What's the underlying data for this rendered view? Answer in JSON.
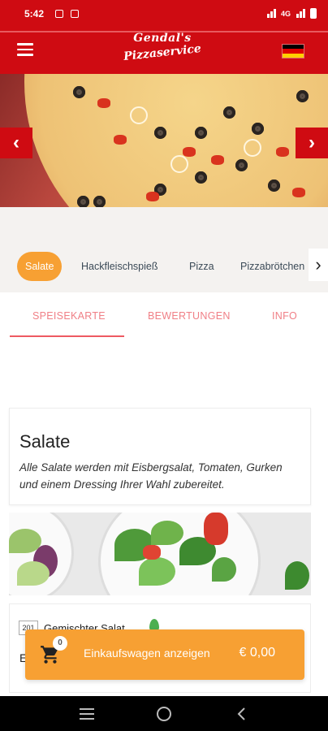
{
  "status_bar": {
    "time": "5:42",
    "network": "4G"
  },
  "header": {
    "logo_line1": "Gendal's",
    "logo_line2": "Pizzaservice",
    "language": "de"
  },
  "hero": {
    "prev_icon": "chevron-left-icon",
    "next_icon": "chevron-right-icon"
  },
  "categories": {
    "items": [
      "Salate",
      "Hackfleischspieß",
      "Pizza",
      "Pizzabrötchen"
    ],
    "active": "Salate"
  },
  "tabs": {
    "items": [
      "SPEISEKARTE",
      "BEWERTUNGEN",
      "INFO"
    ],
    "active": "SPEISEKARTE"
  },
  "section": {
    "title": "Salate",
    "description": "Alle Salate werden mit Eisbergsalat, Tomaten, Gurken und einem Dressing Ihrer Wahl zubereitet."
  },
  "item": {
    "number": "201",
    "name": "Gemischter Salat",
    "more": "E"
  },
  "cart": {
    "count": "0",
    "label": "Einkaufswagen anzeigen",
    "total": "€ 0,00"
  },
  "colors": {
    "brand_red": "#cf0b12",
    "accent_orange": "#f7a033",
    "tab_pink": "#ee5a62"
  }
}
